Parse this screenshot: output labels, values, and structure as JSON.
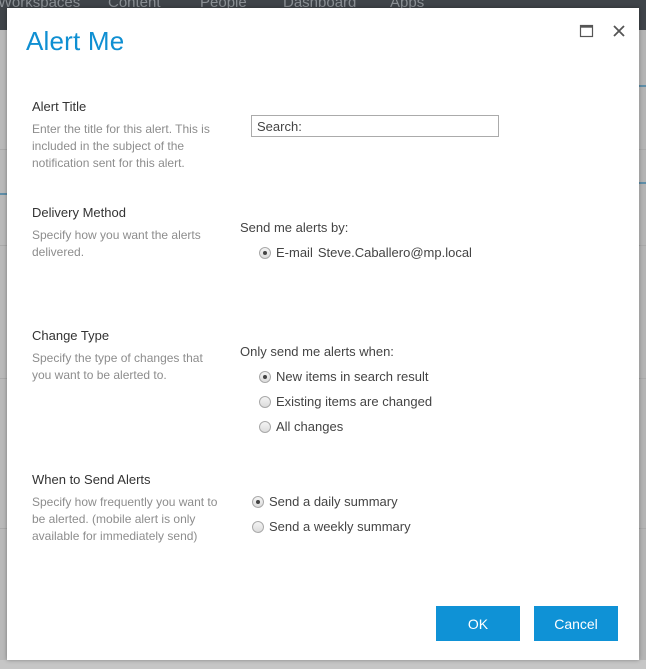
{
  "background": {
    "nav_items": [
      "Workspaces",
      "Content",
      "People",
      "Dashboard",
      "Apps"
    ]
  },
  "dialog": {
    "title": "Alert Me",
    "window_controls": {
      "maximize_icon": "maximize-icon",
      "close_icon": "close-icon"
    },
    "sections": {
      "alert_title": {
        "label": "Alert Title",
        "description": "Enter the title for this alert. This is included in the subject of the notification sent for this alert.",
        "input_value": "Search:"
      },
      "delivery_method": {
        "label": "Delivery Method",
        "description": "Specify how you want the alerts delivered.",
        "prompt": "Send me alerts by:",
        "options": [
          {
            "label": "E-mail",
            "detail": "Steve.Caballero@mp.local",
            "checked": true
          }
        ]
      },
      "change_type": {
        "label": "Change Type",
        "description": "Specify the type of changes that you want to be alerted to.",
        "prompt": "Only send me alerts when:",
        "options": [
          {
            "label": "New items in search result",
            "checked": true
          },
          {
            "label": "Existing items are changed",
            "checked": false
          },
          {
            "label": "All changes",
            "checked": false
          }
        ]
      },
      "when_to_send": {
        "label": "When to Send Alerts",
        "description": "Specify how frequently you want to be alerted. (mobile alert is only available for immediately send)",
        "options": [
          {
            "label": "Send a daily summary",
            "checked": true
          },
          {
            "label": "Send a weekly summary",
            "checked": false
          }
        ]
      }
    },
    "buttons": {
      "ok": "OK",
      "cancel": "Cancel"
    },
    "colors": {
      "accent": "#0f92d6",
      "title": "#0f8fd2"
    }
  }
}
